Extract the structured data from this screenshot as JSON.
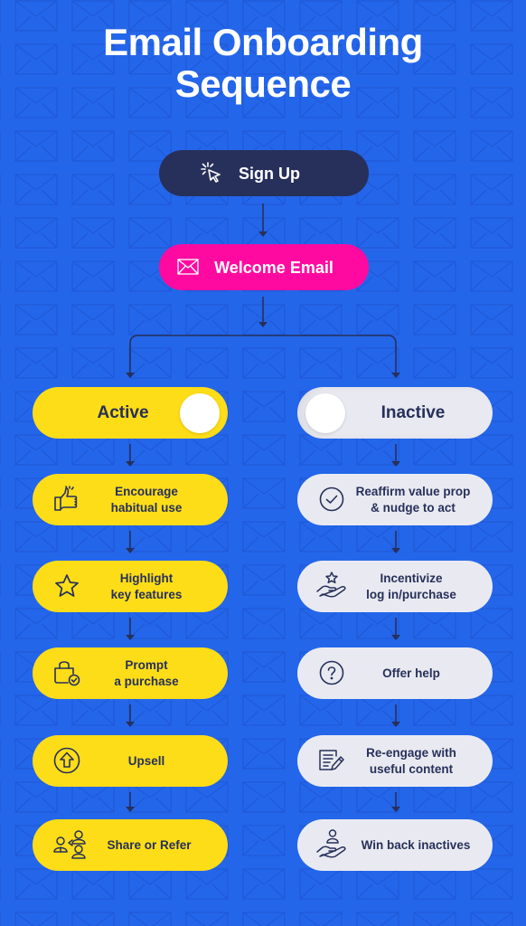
{
  "title": {
    "line1": "Email Onboarding",
    "line2": "Sequence"
  },
  "colors": {
    "background": "#2466ea",
    "sign_up": "#27305a",
    "welcome": "#ff0aa0",
    "active": "#fddd17",
    "inactive": "#e9eaf1",
    "text_dark": "#27305a",
    "connector": "#27305a"
  },
  "start": {
    "label": "Sign Up",
    "icon": "cursor-click-icon"
  },
  "welcome": {
    "label": "Welcome Email",
    "icon": "envelope-icon"
  },
  "branches": {
    "active": {
      "label": "Active",
      "toggle_on": true,
      "steps": [
        {
          "label": "Encourage habitual use",
          "lines": [
            "Encourage",
            "habitual use"
          ],
          "icon": "thumbs-up-icon"
        },
        {
          "label": "Highlight key features",
          "lines": [
            "Highlight",
            "key features"
          ],
          "icon": "star-icon"
        },
        {
          "label": "Prompt a purchase",
          "lines": [
            "Prompt",
            "a purchase"
          ],
          "icon": "shopping-bag-check-icon"
        },
        {
          "label": "Upsell",
          "lines": [
            "Upsell"
          ],
          "icon": "arrow-up-circle-icon"
        },
        {
          "label": "Share or Refer",
          "lines": [
            "Share or Refer"
          ],
          "icon": "share-refer-people-icon"
        }
      ]
    },
    "inactive": {
      "label": "Inactive",
      "toggle_on": false,
      "steps": [
        {
          "label": "Reaffirm value prop & nudge to act",
          "lines": [
            "Reaffirm value prop",
            "& nudge to act"
          ],
          "icon": "check-circle-icon"
        },
        {
          "label": "Incentivize log in/purchase",
          "lines": [
            "Incentivize",
            "log in/purchase"
          ],
          "icon": "hand-star-icon"
        },
        {
          "label": "Offer help",
          "lines": [
            "Offer help"
          ],
          "icon": "question-circle-icon"
        },
        {
          "label": "Re-engage with useful content",
          "lines": [
            "Re-engage with",
            "useful content"
          ],
          "icon": "document-pencil-icon"
        },
        {
          "label": "Win back inactives",
          "lines": [
            "Win back inactives"
          ],
          "icon": "hand-person-icon"
        }
      ]
    }
  }
}
